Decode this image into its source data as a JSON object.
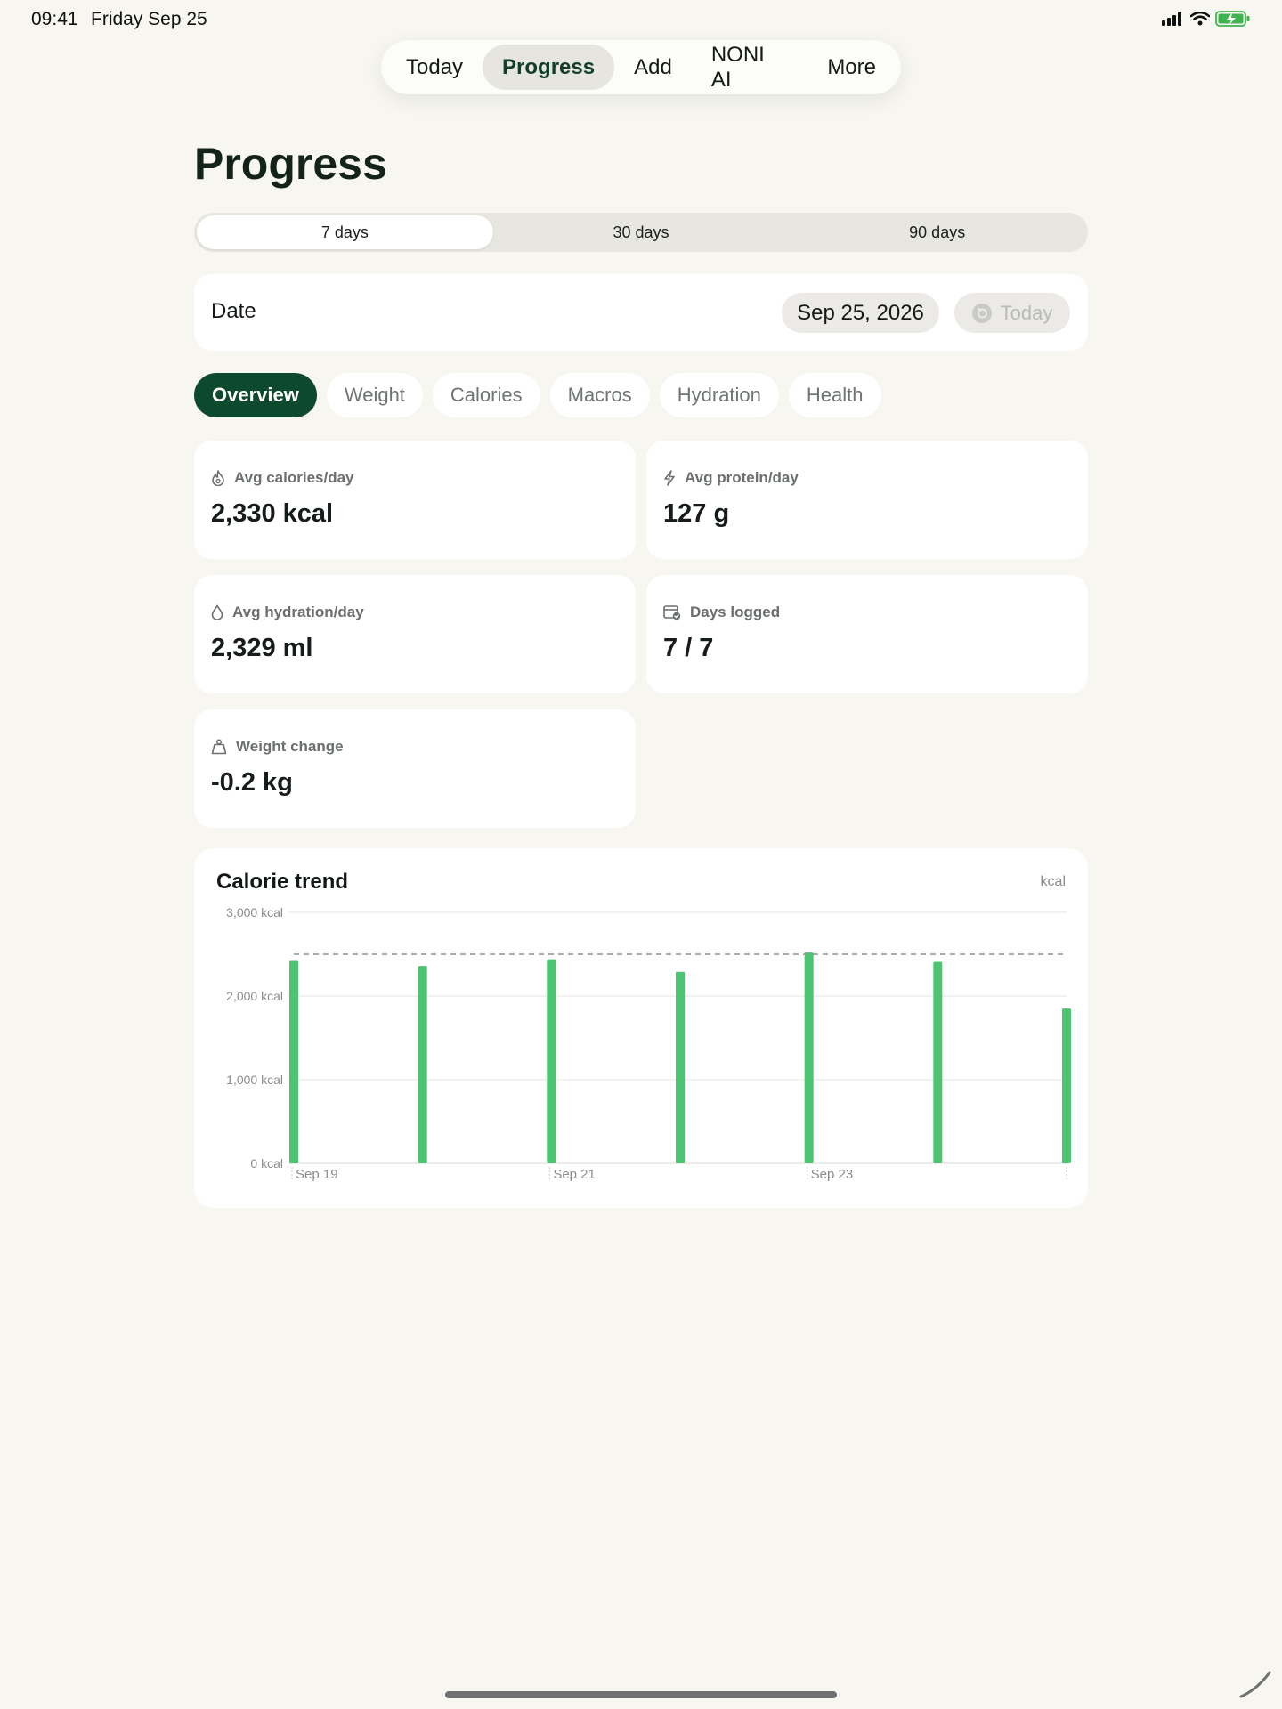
{
  "status": {
    "time": "09:41",
    "date": "Friday Sep 25"
  },
  "nav": {
    "items": [
      "Today",
      "Progress",
      "Add",
      "NONI AI",
      "More"
    ],
    "active": "Progress"
  },
  "page": {
    "title": "Progress"
  },
  "range": {
    "options": [
      "7 days",
      "30 days",
      "90 days"
    ],
    "active": "7 days"
  },
  "date_card": {
    "label": "Date",
    "value": "Sep 25, 2026",
    "today_label": "Today"
  },
  "filters": {
    "items": [
      "Overview",
      "Weight",
      "Calories",
      "Macros",
      "Hydration",
      "Health"
    ],
    "active": "Overview"
  },
  "stats": {
    "avg_calories": {
      "label": "Avg calories/day",
      "value": "2,330 kcal",
      "icon": "flame-icon"
    },
    "avg_protein": {
      "label": "Avg protein/day",
      "value": "127 g",
      "icon": "lightning-icon"
    },
    "avg_hydration": {
      "label": "Avg hydration/day",
      "value": "2,329 ml",
      "icon": "droplet-icon"
    },
    "days_logged": {
      "label": "Days logged",
      "value": "7 / 7",
      "icon": "calendar-check-icon"
    },
    "weight_change": {
      "label": "Weight change",
      "value": "-0.2 kg",
      "icon": "weight-icon"
    }
  },
  "chart": {
    "title": "Calorie trend",
    "unit": "kcal"
  },
  "chart_data": {
    "type": "bar",
    "categories": [
      "Sep 19",
      "Sep 20",
      "Sep 21",
      "Sep 22",
      "Sep 23",
      "Sep 24",
      "Sep 25"
    ],
    "x_tick_labels": [
      "Sep 19",
      "Sep 21",
      "Sep 23"
    ],
    "values": [
      2420,
      2360,
      2440,
      2290,
      2520,
      2410,
      1850
    ],
    "target": 2500,
    "ylim": [
      0,
      3000
    ],
    "y_ticks": [
      0,
      1000,
      2000,
      3000
    ],
    "y_tick_labels": [
      "0 kcal",
      "1,000 kcal",
      "2,000 kcal",
      "3,000 kcal"
    ],
    "bar_color": "#4cc472",
    "target_line_style": "dashed",
    "grid": true
  },
  "colors": {
    "accent": "#0d4a2d",
    "background": "#f7f6f1",
    "bar": "#4cc472"
  }
}
